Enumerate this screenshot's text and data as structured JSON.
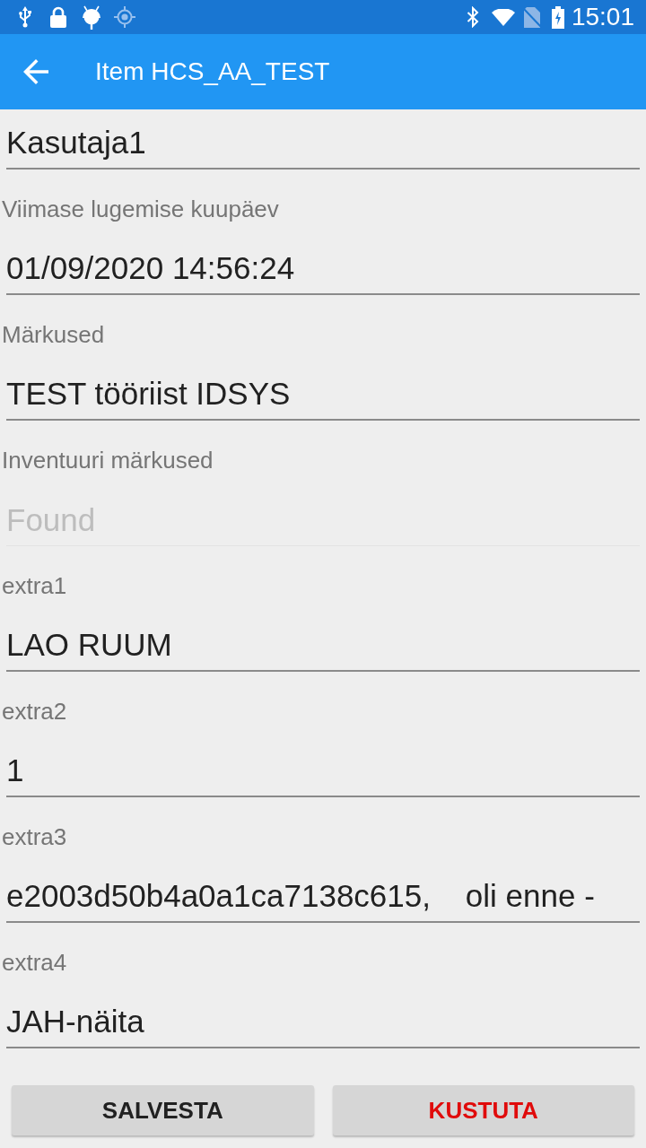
{
  "status_bar": {
    "time": "15:01"
  },
  "app_bar": {
    "title": "Item HCS_AA_TEST"
  },
  "fields": [
    {
      "value": "Kasutaja1",
      "disabled": false
    },
    {
      "label": "Viimase lugemise kuupäev",
      "value": "01/09/2020 14:56:24",
      "disabled": false
    },
    {
      "label": "Märkused",
      "value": "TEST tööriist IDSYS",
      "disabled": false
    },
    {
      "label": "Inventuuri märkused",
      "placeholder": "Found",
      "disabled": true
    },
    {
      "label": "extra1",
      "value": "LAO RUUM",
      "disabled": false
    },
    {
      "label": "extra2",
      "value": "1",
      "disabled": false
    },
    {
      "label": "extra3",
      "value": "e2003d50b4a0a1ca7138c615,    oli enne -",
      "disabled": false
    },
    {
      "label": "extra4",
      "value": "JAH-näita",
      "disabled": false
    }
  ],
  "buttons": [
    {
      "label": "SALVESTA",
      "kind": "save"
    },
    {
      "label": "KUSTUTA",
      "kind": "delete"
    }
  ]
}
